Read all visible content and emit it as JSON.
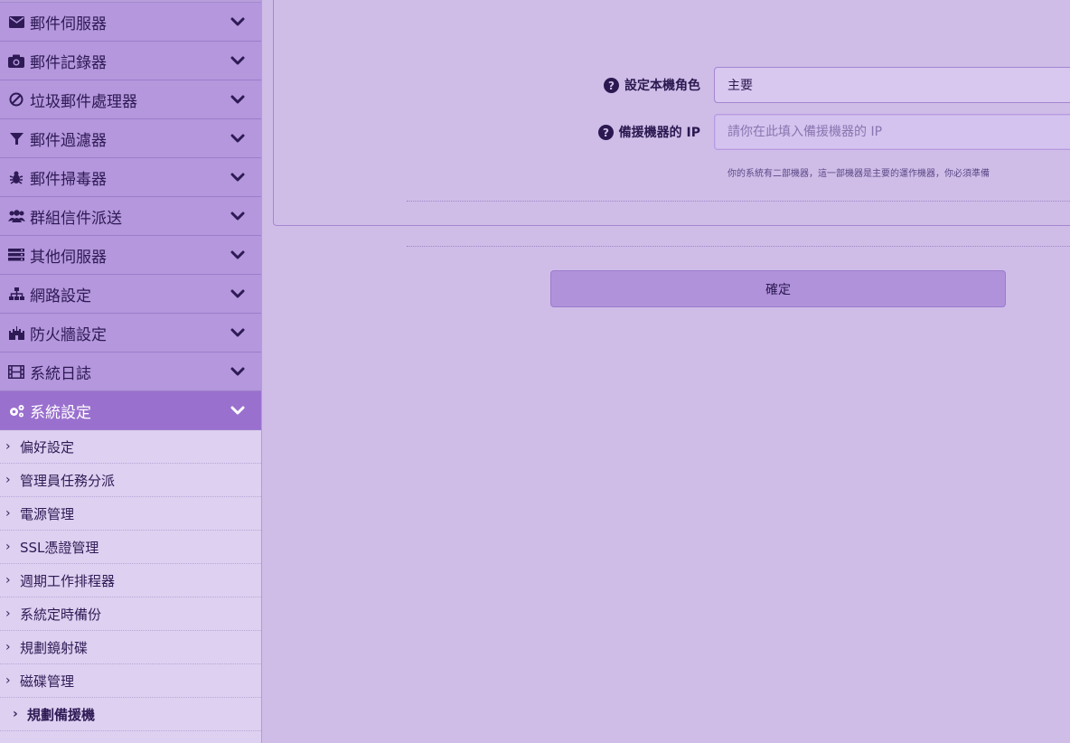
{
  "sidebar": {
    "menu": [
      {
        "label": "郵件伺服器",
        "icon": "envelope-icon"
      },
      {
        "label": "郵件記錄器",
        "icon": "camera-icon"
      },
      {
        "label": "垃圾郵件處理器",
        "icon": "ban-icon"
      },
      {
        "label": "郵件過濾器",
        "icon": "filter-icon"
      },
      {
        "label": "郵件掃毒器",
        "icon": "bug-icon"
      },
      {
        "label": "群組信件派送",
        "icon": "users-icon"
      },
      {
        "label": "其他伺服器",
        "icon": "server-icon"
      },
      {
        "label": "網路設定",
        "icon": "sitemap-icon"
      },
      {
        "label": "防火牆設定",
        "icon": "fortress-icon"
      },
      {
        "label": "系統日誌",
        "icon": "film-icon"
      },
      {
        "label": "系統設定",
        "icon": "gears-icon",
        "active": true
      }
    ],
    "submenu": [
      "偏好設定",
      "管理員任務分派",
      "電源管理",
      "SSL憑證管理",
      "週期工作排程器",
      "系統定時備份",
      "規劃鏡射碟",
      "磁碟管理",
      "規劃備援機"
    ],
    "current_submenu": "規劃備援機"
  },
  "form": {
    "role_label": "設定本機角色",
    "role_value": "主要",
    "backup_ip_label": "備援機器的 IP",
    "backup_ip_placeholder": "請你在此填入備援機器的 IP",
    "hint": "你的系統有二部機器，這一部機器是主要的運作機器，你必須準備"
  },
  "confirm_label": "確定",
  "colors": {
    "background": "#cfbde8",
    "menu": "#b497dc",
    "menu_active": "#9a70cf",
    "button": "#b092db"
  }
}
